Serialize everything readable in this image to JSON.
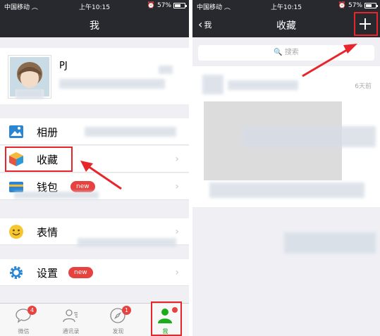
{
  "status": {
    "carrier": "中国移动",
    "time": "上午10:15",
    "battery": "57%",
    "battery_level": 0.57
  },
  "left": {
    "title": "我",
    "profile": {
      "name": "PJ"
    },
    "menu": {
      "album": "相册",
      "favorites": "收藏",
      "wallet": "钱包",
      "stickers": "表情",
      "settings": "设置"
    },
    "badge_new": "new",
    "tabs": [
      {
        "label": "微信",
        "badge": "4"
      },
      {
        "label": "通讯录"
      },
      {
        "label": "发现",
        "badge": "1"
      },
      {
        "label": "我"
      }
    ]
  },
  "right": {
    "back_label": "我",
    "title": "收藏",
    "search_placeholder": "搜索",
    "item_time": "6天前"
  },
  "colors": {
    "navbar": "#27292e",
    "accent_green": "#1aad19",
    "badge_red": "#e64340",
    "highlight_red": "#e8252a"
  }
}
